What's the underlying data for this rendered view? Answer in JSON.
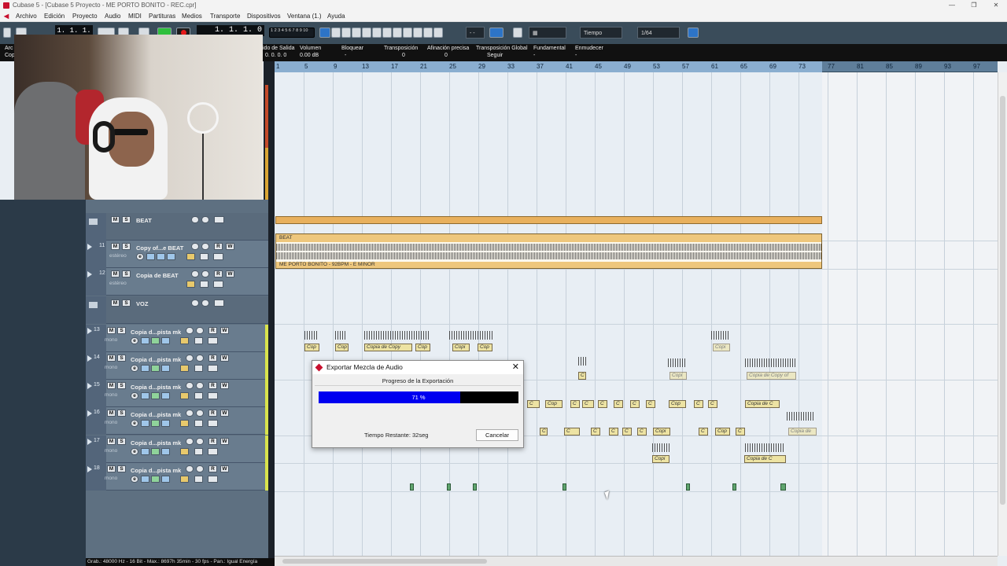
{
  "window": {
    "title": "Cubase 5 - [Cubase 5 Proyecto - ME PORTO BONITO - REC.cpr]",
    "controls": [
      "—",
      "❐",
      "✕"
    ]
  },
  "menu": [
    "Archivo",
    "Edición",
    "Proyecto",
    "Audio",
    "MIDI",
    "Partituras",
    "Medios",
    "Transporte",
    "Dispositivos",
    "Ventana (1.)",
    "Ayuda"
  ],
  "toolbar": {
    "counter_left": "1. 1. 1.",
    "counter_right": "1. 1. 1.  0",
    "num_grid": "1 2 3 4 5 6 7 8 9 10",
    "snap_select": "Tiempo",
    "quant_select": "1/64",
    "dash_select": "- -"
  },
  "infoline": {
    "left_top": "Arc",
    "left_bottom": "Cop",
    "fields": [
      {
        "label": "ido de Salida",
        "value": "0. 0. 0.   0"
      },
      {
        "label": "Volumen",
        "value": "0.00 dB"
      },
      {
        "label": "Bloquear",
        "value": "-"
      },
      {
        "label": "Transposición",
        "value": "0"
      },
      {
        "label": "Afinación precisa",
        "value": "0"
      },
      {
        "label": "Transposición Global",
        "value": "Seguir"
      },
      {
        "label": "Fundamental",
        "value": "-"
      },
      {
        "label": "Enmudecer",
        "value": "-"
      }
    ]
  },
  "ruler": [
    "1",
    "5",
    "9",
    "13",
    "17",
    "21",
    "25",
    "29",
    "33",
    "37",
    "41",
    "45",
    "49",
    "53",
    "57",
    "61",
    "65",
    "69",
    "73",
    "77",
    "81",
    "85",
    "89",
    "93",
    "97"
  ],
  "tracks": [
    {
      "num": "",
      "name": "BEAT",
      "sub": "",
      "type": "folder"
    },
    {
      "num": "11",
      "name": "Copy of...e BEAT",
      "sub": "estéreo",
      "type": "audio"
    },
    {
      "num": "12",
      "name": "Copia de BEAT",
      "sub": "estéreo",
      "type": "audio"
    },
    {
      "num": "",
      "name": "VOZ",
      "sub": "",
      "type": "folder"
    },
    {
      "num": "13",
      "name": "Copia d...pista mk",
      "sub": "mono",
      "type": "audio"
    },
    {
      "num": "14",
      "name": "Copia d...pista mk",
      "sub": "mono",
      "type": "audio"
    },
    {
      "num": "15",
      "name": "Copia d...pista mk",
      "sub": "mono",
      "type": "audio"
    },
    {
      "num": "16",
      "name": "Copia d...pista mk",
      "sub": "mono",
      "type": "audio"
    },
    {
      "num": "17",
      "name": "Copia d...pista mk",
      "sub": "mono",
      "type": "audio"
    },
    {
      "num": "18",
      "name": "Copia d...pista mk",
      "sub": "mono",
      "type": "audio"
    }
  ],
  "button_labels": {
    "mute": "M",
    "solo": "S",
    "read": "R",
    "write": "W",
    "edit": "e"
  },
  "events": {
    "beat_label": "BEAT",
    "song_label": "ME PORTO BONITO - 92BPM - E MINOR",
    "copia_short": "Copi",
    "copia_long": "Copia de Copy",
    "copia_de": "Copia de C",
    "copia_de_copy_of": "Copia de Copy of",
    "copia_de_mid": "Copia de",
    "cop": "Cop",
    "c": "C"
  },
  "dialog": {
    "title": "Exportar Mezcla de Audio",
    "heading": "Progreso de la Exportación",
    "progress": 0.71,
    "progress_text": "71 %",
    "remaining": "Tiempo Restante: 32seg",
    "cancel": "Cancelar"
  },
  "status": "Grab.: 48000 Hz - 16 Bit - Max.: 8697h 35min - 30 fps - Pan.: Igual Energía"
}
